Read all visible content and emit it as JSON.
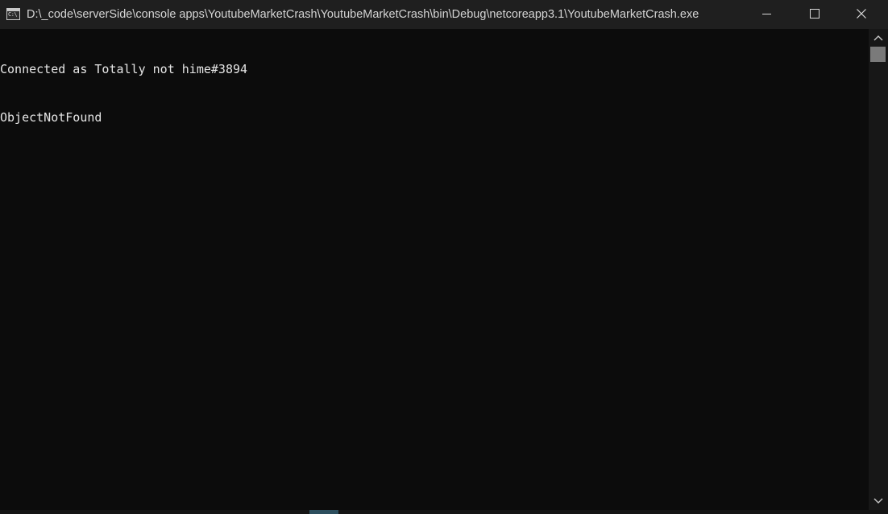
{
  "window": {
    "title": "D:\\_code\\serverSide\\console apps\\YoutubeMarketCrash\\YoutubeMarketCrash\\bin\\Debug\\netcoreapp3.1\\YoutubeMarketCrash.exe",
    "icon_glyph": "C:\\",
    "icon": "console-app-icon"
  },
  "console": {
    "lines": [
      "Connected as Totally not hime#3894",
      "ObjectNotFound"
    ],
    "text_color": "#e6e6e6",
    "background": "#0c0c0c"
  },
  "controls": {
    "minimize_icon": "minimize-icon",
    "maximize_icon": "maximize-icon",
    "close_icon": "close-icon"
  },
  "scrollbar": {
    "up_icon": "chevron-up-icon",
    "down_icon": "chevron-down-icon"
  }
}
